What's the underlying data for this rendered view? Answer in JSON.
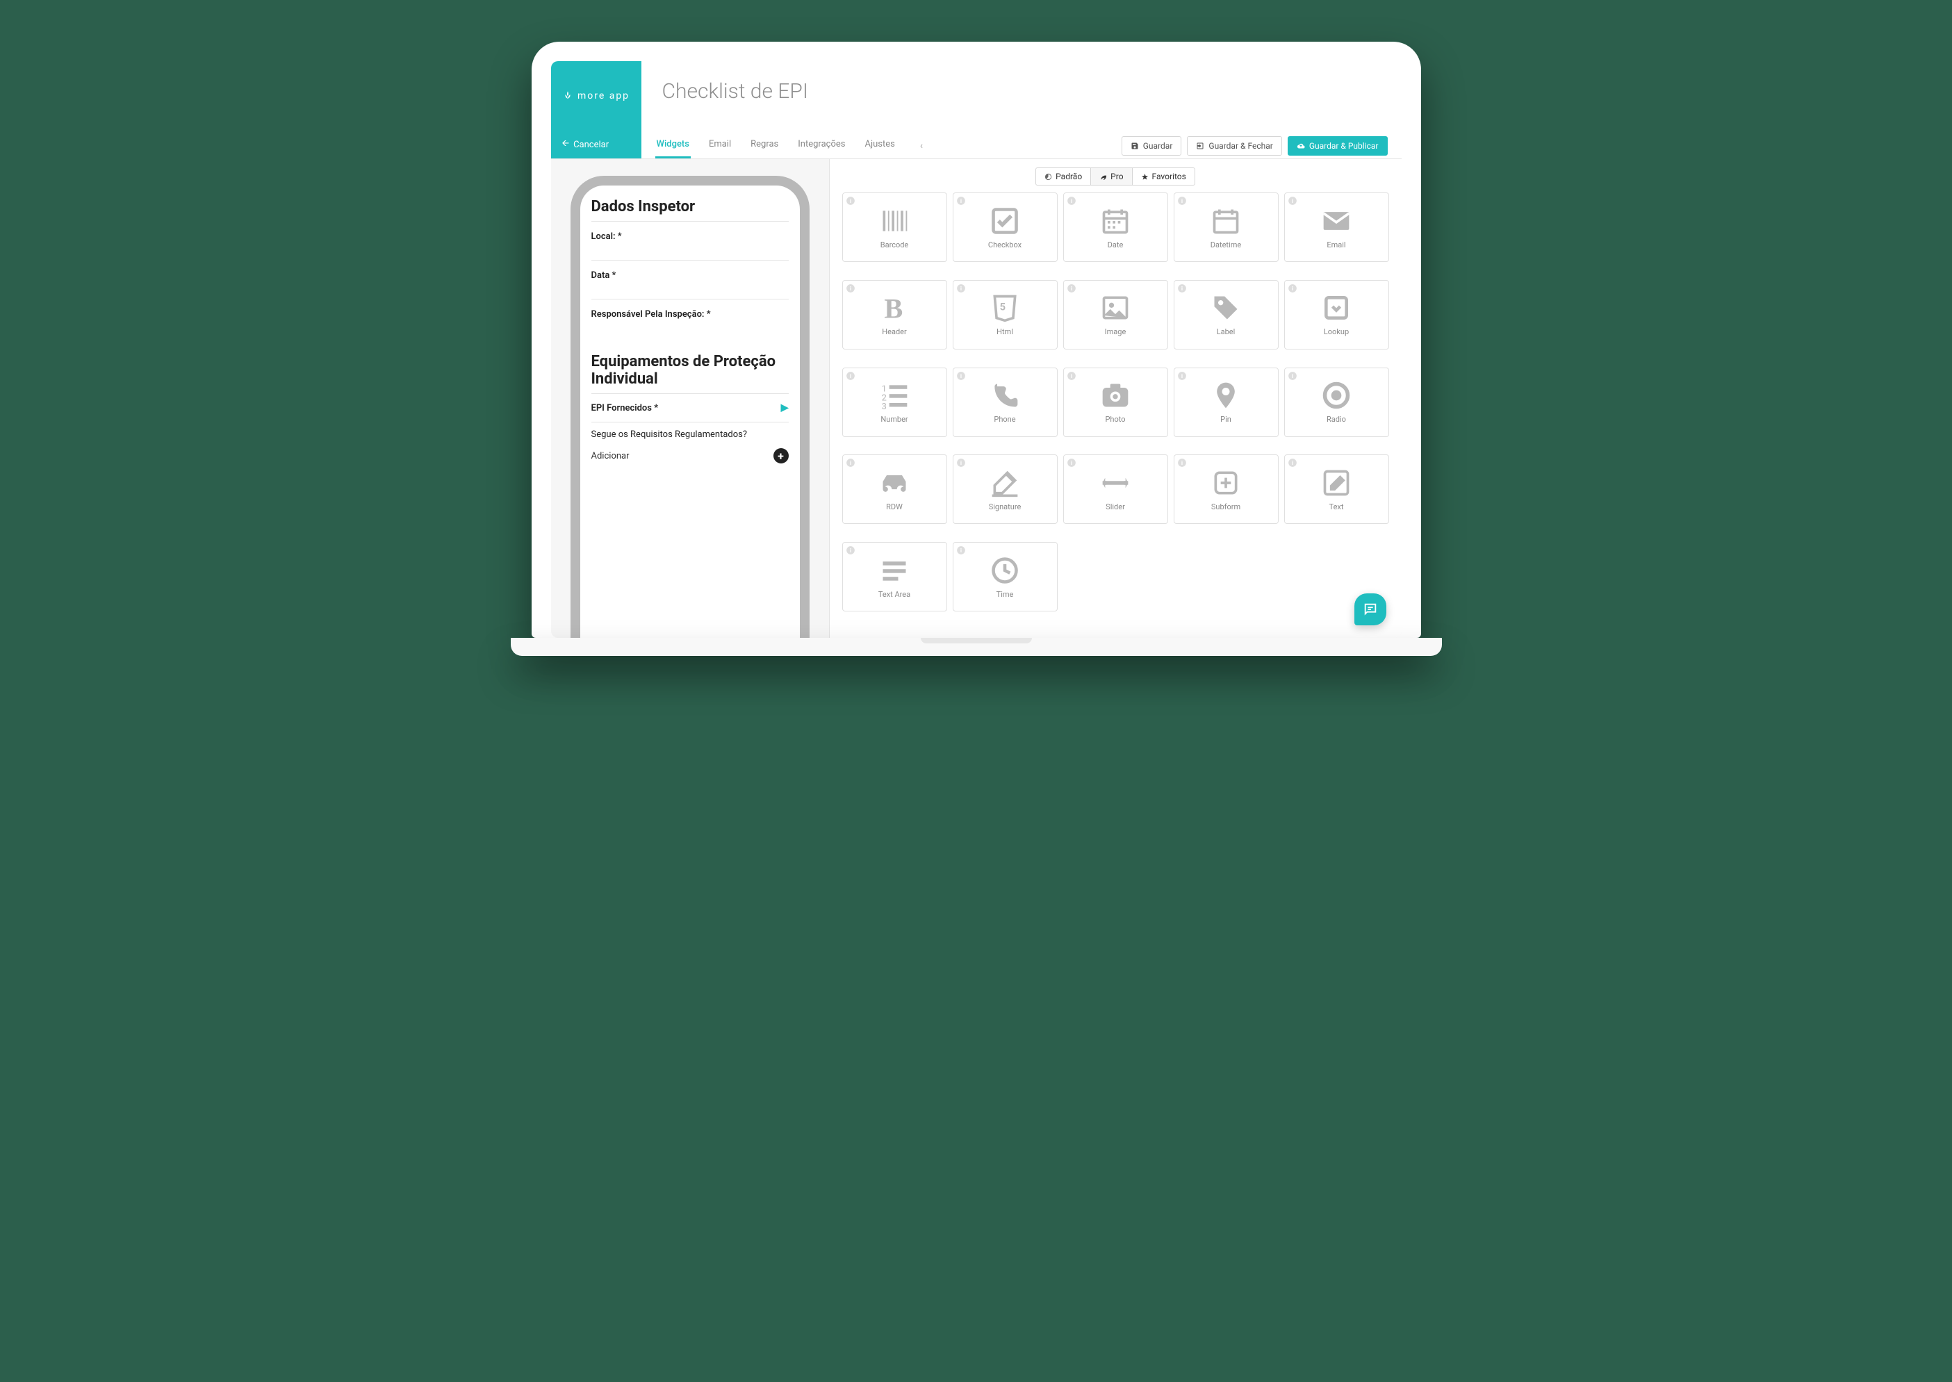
{
  "brand": "more app",
  "page_title": "Checklist de EPI",
  "top": {
    "cancel": "Cancelar",
    "tabs": [
      "Widgets",
      "Email",
      "Regras",
      "Integrações",
      "Ajustes"
    ],
    "actions": {
      "save": "Guardar",
      "save_close": "Guardar & Fechar",
      "save_publish": "Guardar & Publicar"
    }
  },
  "preview": {
    "section1": "Dados Inspetor",
    "fields": [
      "Local: *",
      "Data *",
      "Responsável Pela Inspeção: *"
    ],
    "section2": "Equipamentos de Proteção Individual",
    "subform_label": "EPI Fornecidos *",
    "question": "Segue os Requisitos Regulamentados?",
    "add": "Adicionar"
  },
  "widget_tabs": {
    "padrao": "Padrão",
    "pro": "Pro",
    "fav": "Favoritos"
  },
  "widgets": [
    {
      "name": "Barcode"
    },
    {
      "name": "Checkbox"
    },
    {
      "name": "Date"
    },
    {
      "name": "Datetime"
    },
    {
      "name": "Email"
    },
    {
      "name": "Header"
    },
    {
      "name": "Html"
    },
    {
      "name": "Image"
    },
    {
      "name": "Label"
    },
    {
      "name": "Lookup"
    },
    {
      "name": "Number"
    },
    {
      "name": "Phone"
    },
    {
      "name": "Photo"
    },
    {
      "name": "Pin"
    },
    {
      "name": "Radio"
    },
    {
      "name": "RDW"
    },
    {
      "name": "Signature"
    },
    {
      "name": "Slider"
    },
    {
      "name": "Subform"
    },
    {
      "name": "Text"
    },
    {
      "name": "Text Area"
    },
    {
      "name": "Time"
    }
  ]
}
